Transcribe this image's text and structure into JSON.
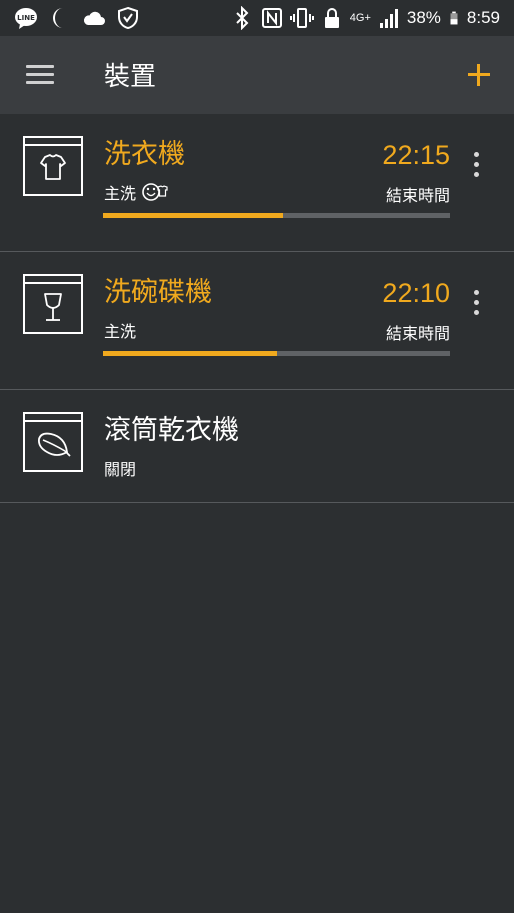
{
  "status_bar": {
    "left_icons": [
      "line-app-icon",
      "moon-icon",
      "cloud-icon",
      "shield-icon"
    ],
    "right_icons": [
      "bluetooth-icon",
      "nfc-icon",
      "vibrate-icon",
      "lock-icon",
      "signal-icon",
      "battery-icon"
    ],
    "network": "4G+",
    "battery": "38%",
    "time": "8:59"
  },
  "app_bar": {
    "menu_icon": "hamburger-menu-icon",
    "title": "裝置",
    "add_icon": "plus-icon"
  },
  "accent_color": "#f0a91e",
  "devices": [
    {
      "icon": "washer-shirt-icon",
      "name": "洗衣機",
      "status": "主洗",
      "status_icon": "smiley-shirt-icon",
      "time": "22:15",
      "time_label": "結束時間",
      "progress": 0.52,
      "active": true
    },
    {
      "icon": "dishwasher-glass-icon",
      "name": "洗碗碟機",
      "status": "主洗",
      "time": "22:10",
      "time_label": "結束時間",
      "progress": 0.5,
      "active": true
    },
    {
      "icon": "dryer-feather-icon",
      "name": "滾筒乾衣機",
      "status": "關閉",
      "active": false
    }
  ]
}
